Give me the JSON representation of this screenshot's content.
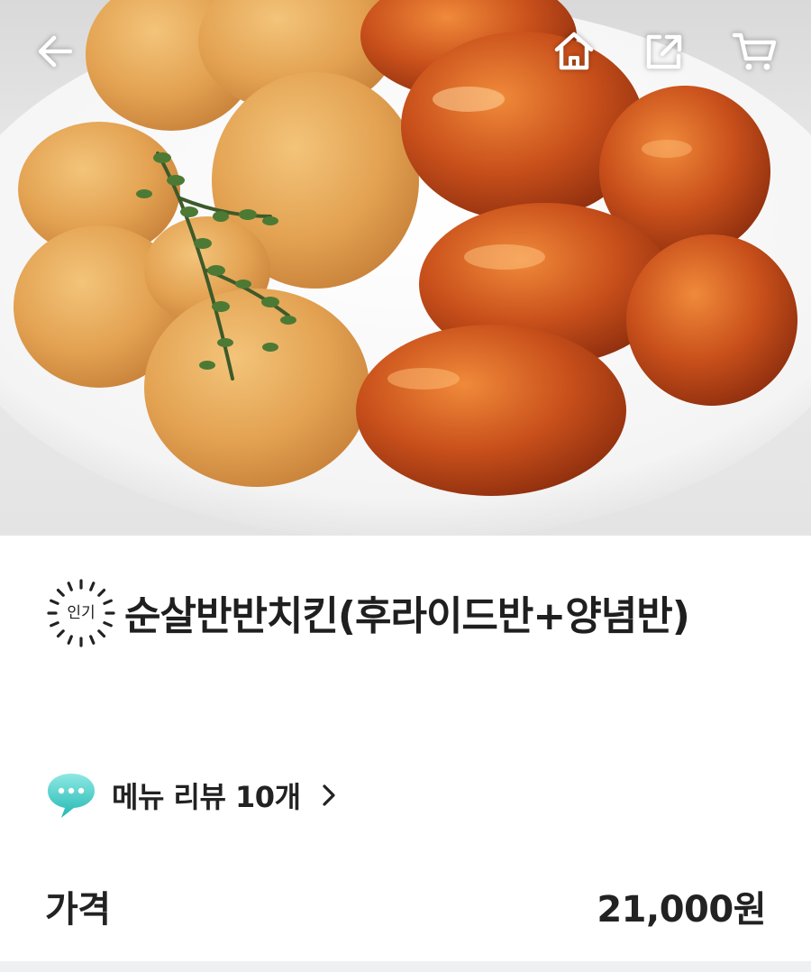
{
  "hero": {
    "image_alt": "순살반반치킨"
  },
  "topbar": {
    "icons": [
      "back-arrow-icon",
      "home-icon",
      "share-icon",
      "cart-icon"
    ]
  },
  "product": {
    "badge": "인기",
    "title": "순살반반치킨(후라이드반+양념반)"
  },
  "review": {
    "label": "메뉴 리뷰 10개",
    "icon": "speech-bubble-icon",
    "icon_color": "#2ac1bc"
  },
  "price": {
    "label": "가격",
    "value": "21,000원"
  }
}
